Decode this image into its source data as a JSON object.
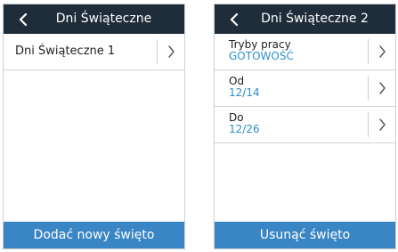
{
  "screens": [
    {
      "title": "Dni Świąteczne",
      "back_icon": "chevron-left-icon",
      "items": [
        {
          "label": "Dni Świąteczne 1",
          "icon": "chevron-right-icon"
        }
      ],
      "footer_button": "Dodać nowy święto"
    },
    {
      "title": "Dni Świąteczne 2",
      "back_icon": "chevron-left-icon",
      "fields": [
        {
          "label": "Tryby pracy",
          "value": "GOTOWOŚĆ",
          "icon": "chevron-right-icon"
        },
        {
          "label": "Od",
          "value": "12/14",
          "icon": "chevron-right-icon"
        },
        {
          "label": "Do",
          "value": "12/26",
          "icon": "chevron-right-icon"
        }
      ],
      "footer_button": "Usunąć święto"
    }
  ],
  "colors": {
    "header_bg": "#1f2c39",
    "accent": "#3a86c5",
    "value_text": "#2b8fcc",
    "divider": "#d4d4d4"
  }
}
